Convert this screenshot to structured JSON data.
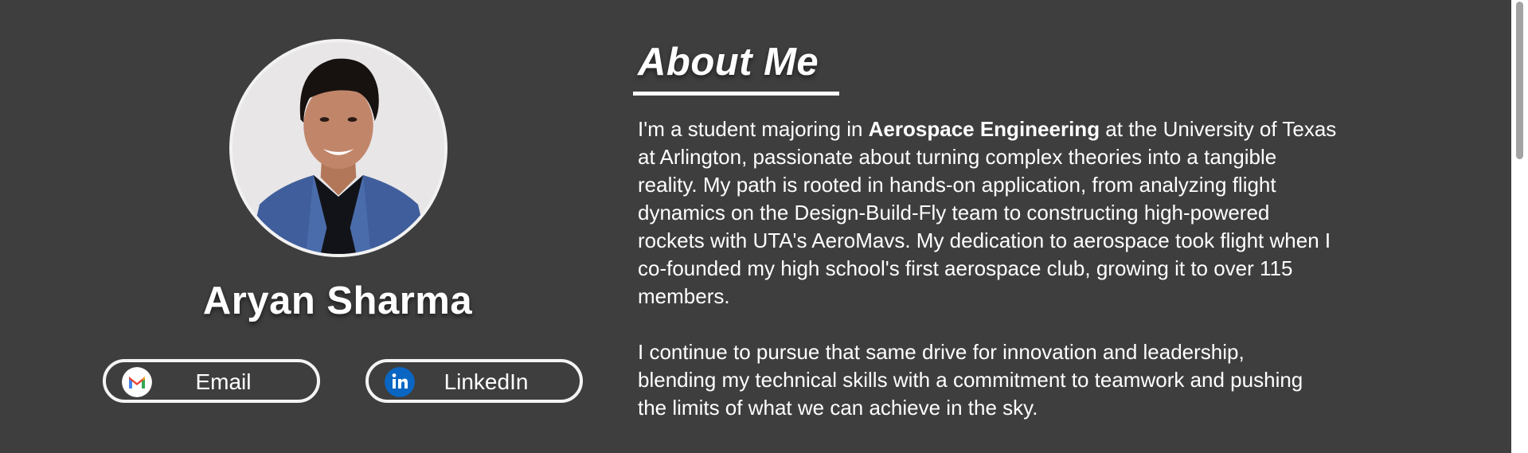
{
  "profile": {
    "name": "Aryan Sharma",
    "email_label": "Email",
    "linkedin_label": "LinkedIn"
  },
  "about": {
    "heading": "About Me",
    "paragraph1": {
      "before": "I'm a student majoring in ",
      "bold": "Aerospace Engineering",
      "line1_end": " at the University of Texas",
      "line2": "at Arlington, passionate about turning complex theories into a tangible",
      "line3": "reality. My path is rooted in hands-on application, from analyzing flight",
      "line4": "dynamics on the Design-Build-Fly team to constructing high-powered",
      "line5": "rockets with UTA's AeroMavs. My dedication to aerospace took flight when I",
      "line6": "co-founded my high school's first aerospace club, growing it to over 115",
      "line7": "members."
    },
    "paragraph2": {
      "line1": "I continue to pursue that same drive for innovation and leadership,",
      "line2": "blending my technical skills with a commitment to teamwork and pushing",
      "line3": "the limits of what we can achieve in the sky."
    }
  },
  "icons": {
    "email": "gmail-icon",
    "linkedin": "linkedin-icon"
  },
  "colors": {
    "background": "#3e3e3e",
    "text": "#ffffff",
    "linkedin_blue": "#0a66c2"
  }
}
